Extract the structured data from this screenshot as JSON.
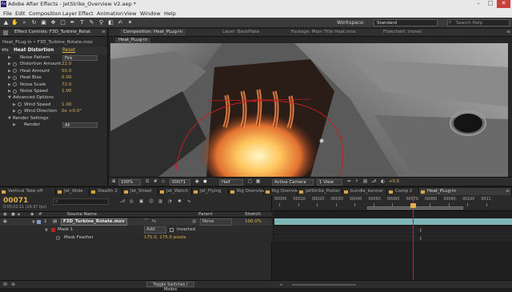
{
  "window": {
    "title": "Adobe After Effects - JetStrike_Overview V2.aep *",
    "controls": [
      "–",
      "□",
      "✕"
    ]
  },
  "menu": [
    "File",
    "Edit",
    "Composition",
    "Layer",
    "Effect",
    "Animation",
    "View",
    "Window",
    "Help"
  ],
  "toolbar": {
    "workspace_label": "Workspace:",
    "workspace_value": "Standard",
    "search_placeholder": "Search Help"
  },
  "effect_controls": {
    "tab_label": "Effect Controls: F3D_Turbine_Rotat",
    "subtitle": "Heat_PLug-in • F3D_Turbine_Rotate.mov",
    "effect_name": "Heat Distortion",
    "reset_label": "Reset",
    "properties": [
      {
        "label": "Noise Pattern",
        "value": "Fire",
        "type": "dropdown"
      },
      {
        "label": "Distortion Amount",
        "value": "22.0",
        "type": "number"
      },
      {
        "label": "Heat Amount",
        "value": "50.0",
        "type": "number"
      },
      {
        "label": "Heat Bias",
        "value": "0.00",
        "type": "number"
      },
      {
        "label": "Noise Scale",
        "value": "72.0",
        "type": "number"
      },
      {
        "label": "Noise Speed",
        "value": "1.00",
        "type": "number"
      },
      {
        "label": "Advanced Options",
        "value": "",
        "type": "group"
      },
      {
        "label": "Wind Speed",
        "value": "1.00",
        "type": "number"
      },
      {
        "label": "Wind Direction",
        "value": "0x +0.0°",
        "type": "number"
      },
      {
        "label": "Render Settings",
        "value": "",
        "type": "group"
      },
      {
        "label": "Render",
        "value": "All",
        "type": "dropdown"
      }
    ]
  },
  "composition": {
    "tabs": [
      "Composition: Heat_PLug-in",
      "Layer: BackPlate",
      "Footage: Main Title Heat.mov",
      "Flowchart: (none)"
    ],
    "sub_tab": "Heat_PLug-in",
    "view_bar": {
      "zoom": "100%",
      "timecode": "00071",
      "resolution": "Half",
      "camera": "Active Camera",
      "views": "1 View",
      "exposure": "+0.0"
    }
  },
  "timeline": {
    "tabs": [
      {
        "label": "Vertical Take off",
        "color": "#d9a441"
      },
      {
        "label": "Jet_Wide",
        "color": "#d9a441"
      },
      {
        "label": "Stealth 2",
        "color": "#d9a441"
      },
      {
        "label": "Jet_Street",
        "color": "#d9a441"
      },
      {
        "label": "Jet_Watch",
        "color": "#d9a441"
      },
      {
        "label": "Jet_Flying",
        "color": "#d9a441"
      },
      {
        "label": "Rig Overview",
        "color": "#d9a441"
      },
      {
        "label": "Rig Overview",
        "color": "#d9a441"
      },
      {
        "label": "JetStrike_Poster",
        "color": "#d9a441"
      },
      {
        "label": "bundle_banner",
        "color": "#d9a441"
      },
      {
        "label": "Comp 2",
        "color": "#d9a441"
      },
      {
        "label": "Heat_PLug-in",
        "color": "#d9a441",
        "active": true
      }
    ],
    "timecode": "00071",
    "timecode_sub": "0:00:02:11 (29.97 fps)",
    "columns": {
      "source_name": "Source Name",
      "parent": "Parent",
      "stretch": "Stretch"
    },
    "layer": {
      "number": "1",
      "name": "F3D_Turbine_Rotate.mov",
      "parent": "None",
      "stretch": "100.0%",
      "mask_name": "Mask 1",
      "mask_mode": "Add",
      "mask_inverted": "Inverted",
      "feather_label": "Mask Feather",
      "feather_value": "175.0, 175.0 pixels"
    },
    "ruler": [
      "00000",
      "00010",
      "00020",
      "00030",
      "00040",
      "00050",
      "00060",
      "00070",
      "00080",
      "00090",
      "00100",
      "0011"
    ],
    "playhead_frame": 71,
    "bottom_label": "Toggle Switches / Modes"
  },
  "colors": {
    "accent": "#e0b24a",
    "playhead": "#d02020",
    "layer_bar": "#7fb5b5",
    "mask": "#c02020"
  }
}
